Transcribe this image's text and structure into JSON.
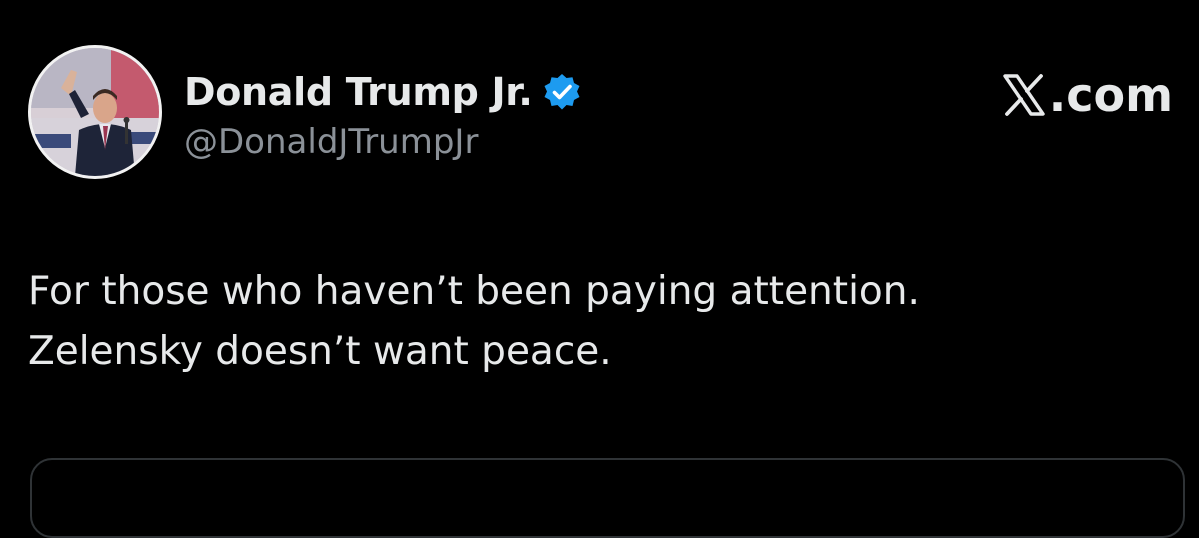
{
  "author": {
    "display_name": "Donald Trump Jr.",
    "handle": "@DonaldJTrumpJr",
    "verified": true
  },
  "brand": {
    "label": ".com",
    "logo_icon": "x-logo-icon"
  },
  "post": {
    "lines": [
      "For those who haven’t been paying attention.",
      "Zelensky doesn’t want peace."
    ]
  },
  "colors": {
    "background": "#000000",
    "text": "#e7e9ea",
    "handle": "#8b9198",
    "verified_badge": "#1d9bf0",
    "card_border": "#2f3336"
  }
}
